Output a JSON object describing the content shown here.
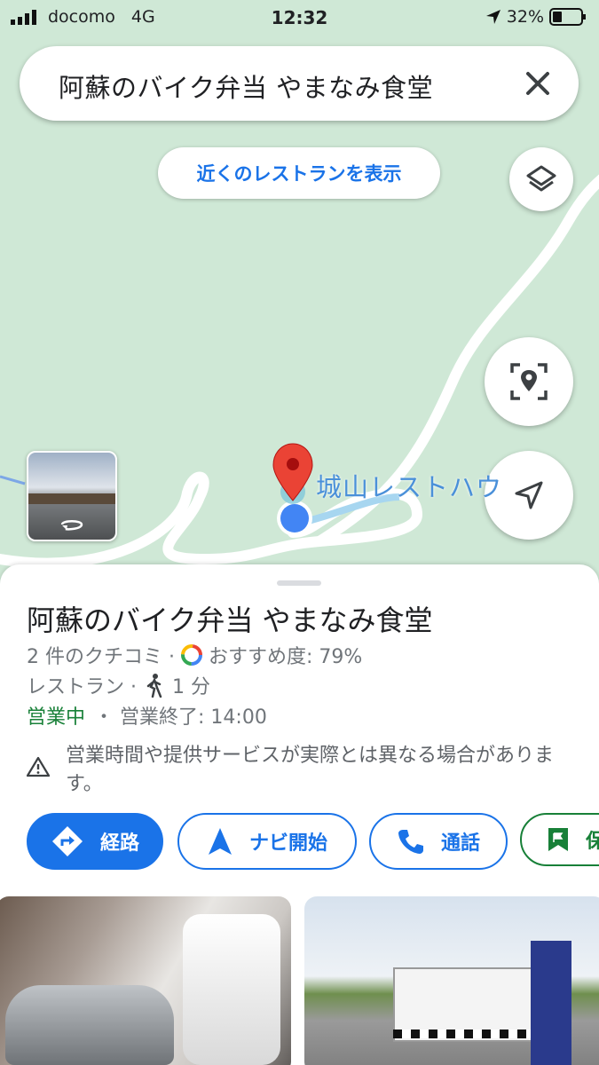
{
  "status_bar": {
    "carrier": "docomo",
    "network": "4G",
    "time": "12:32",
    "battery": "32%"
  },
  "search": {
    "query": "阿蘇のバイク弁当 やまなみ食堂"
  },
  "map": {
    "nearby_chip": "近くのレストランを表示",
    "place_label": "城山レストハウ"
  },
  "place": {
    "name": "阿蘇のバイク弁当 やまなみ食堂",
    "reviews": "2 件のクチコミ ·",
    "recommend": "おすすめ度: 79%",
    "category": "レストラン ·",
    "walk": "1 分",
    "open_status": "営業中",
    "hours": "・ 営業終了: 14:00",
    "warning": "営業時間や提供サービスが実際とは異なる場合があります。"
  },
  "actions": {
    "directions": "経路",
    "navigate": "ナビ開始",
    "call": "通話",
    "save": "保"
  },
  "icons": [
    "signal-icon",
    "location-arrow-icon",
    "battery-icon",
    "close-icon",
    "layers-icon",
    "locate-icon",
    "compass-icon",
    "rotate-icon",
    "directions-icon",
    "navigation-icon",
    "phone-icon",
    "bookmark-icon",
    "warning-icon",
    "walk-icon",
    "google-icon"
  ],
  "colors": {
    "accent": "#1a73e8",
    "open": "#188038",
    "map_bg": "#cfe8d6",
    "pin": "#ea4335"
  }
}
